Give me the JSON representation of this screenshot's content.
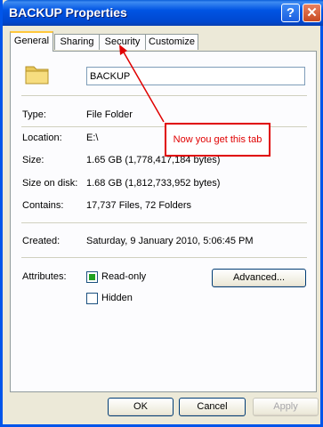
{
  "window": {
    "title": "BACKUP Properties",
    "help_glyph": "?",
    "close_glyph": "✕"
  },
  "tabs": [
    {
      "label": "General",
      "active": true
    },
    {
      "label": "Sharing",
      "active": false
    },
    {
      "label": "Security",
      "active": false
    },
    {
      "label": "Customize",
      "active": false
    }
  ],
  "general": {
    "name": "BACKUP",
    "type_label": "Type:",
    "type_value": "File Folder",
    "location_label": "Location:",
    "location_value": "E:\\",
    "size_label": "Size:",
    "size_value": "1.65 GB (1,778,417,184 bytes)",
    "size_on_disk_label": "Size on disk:",
    "size_on_disk_value": "1.68 GB (1,812,733,952 bytes)",
    "contains_label": "Contains:",
    "contains_value": "17,737 Files, 72 Folders",
    "created_label": "Created:",
    "created_value": "Saturday, 9 January 2010, 5:06:45 PM",
    "attributes_label": "Attributes:",
    "readonly_label": "Read-only",
    "readonly_checked": true,
    "hidden_label": "Hidden",
    "hidden_checked": false,
    "advanced_label": "Advanced..."
  },
  "buttons": {
    "ok": "OK",
    "cancel": "Cancel",
    "apply": "Apply"
  },
  "annotation": {
    "text": "Now you get this tab",
    "color": "#e00000"
  },
  "colors": {
    "titlebar": "#0054e3",
    "tab_highlight": "#ffc83c",
    "window_bg": "#ece9d8"
  }
}
